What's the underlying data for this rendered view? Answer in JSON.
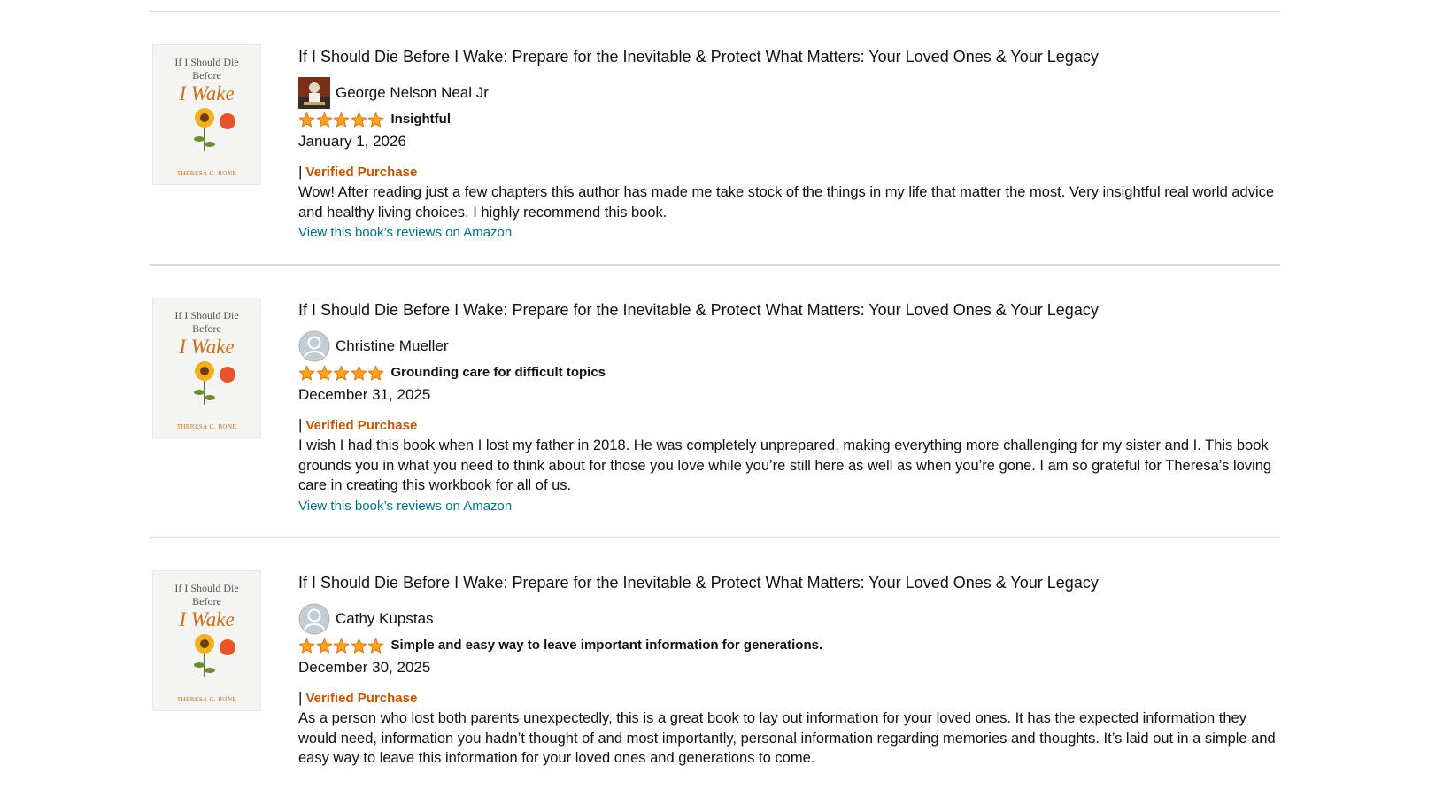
{
  "reviews": [
    {
      "book_title": "If I Should Die Before I Wake: Prepare for the Inevitable & Protect What Matters: Your Loved Ones & Your Legacy",
      "cover": {
        "line1": "If I Should Die",
        "line2": "Before",
        "line3": "I Wake",
        "author": "THERESA C. BONE"
      },
      "reviewer": "George Nelson Neal Jr",
      "avatar": "photo-avatar",
      "rating": 5,
      "rating_max": 5,
      "review_title": "Insightful",
      "date": "January 1, 2026",
      "separator": "|",
      "verified": "Verified Purchase",
      "body": "Wow! After reading just a few chapters this author has made me take stock of the things in my life that matter the most. Very insightful real world advice and healthy living choices. I highly recommend this book.",
      "link": "View this book’s reviews on Amazon"
    },
    {
      "book_title": "If I Should Die Before I Wake: Prepare for the Inevitable & Protect What Matters: Your Loved Ones & Your Legacy",
      "cover": {
        "line1": "If I Should Die",
        "line2": "Before",
        "line3": "I Wake",
        "author": "THERESA C. BONE"
      },
      "reviewer": "Christine Mueller",
      "avatar": "default-avatar",
      "rating": 5,
      "rating_max": 5,
      "review_title": "Grounding care for difficult topics",
      "date": "December 31, 2025",
      "separator": "|",
      "verified": "Verified Purchase",
      "body": "I wish I had this book when I lost my father in 2018. He was completely unprepared, making everything more challenging for my sister and I. This book grounds you in what you need to think about for those you love while you’re still here as well as when you’re gone. I am so grateful for Theresa’s loving care in creating this workbook for all of us.",
      "link": "View this book’s reviews on Amazon"
    },
    {
      "book_title": "If I Should Die Before I Wake: Prepare for the Inevitable & Protect What Matters: Your Loved Ones & Your Legacy",
      "cover": {
        "line1": "If I Should Die",
        "line2": "Before",
        "line3": "I Wake",
        "author": "THERESA C. BONE"
      },
      "reviewer": "Cathy Kupstas",
      "avatar": "default-avatar",
      "rating": 5,
      "rating_max": 5,
      "review_title": "Simple and easy way to leave important information for generations.",
      "date": "December 30, 2025",
      "separator": "|",
      "verified": "Verified Purchase",
      "body": "As a person who lost both parents unexpectedly, this is a great book to lay out information for your loved ones. It has the expected information they would need, information you hadn’t thought of and most importantly, personal information regarding memories and thoughts. It’s laid out in a simple and easy way to leave this information for your loved ones and generations to come.",
      "link": ""
    }
  ],
  "colors": {
    "text": "#0f1111",
    "link": "#007185",
    "verified": "#c45500",
    "star": "#ffa41c",
    "divider": "#dcdede"
  }
}
